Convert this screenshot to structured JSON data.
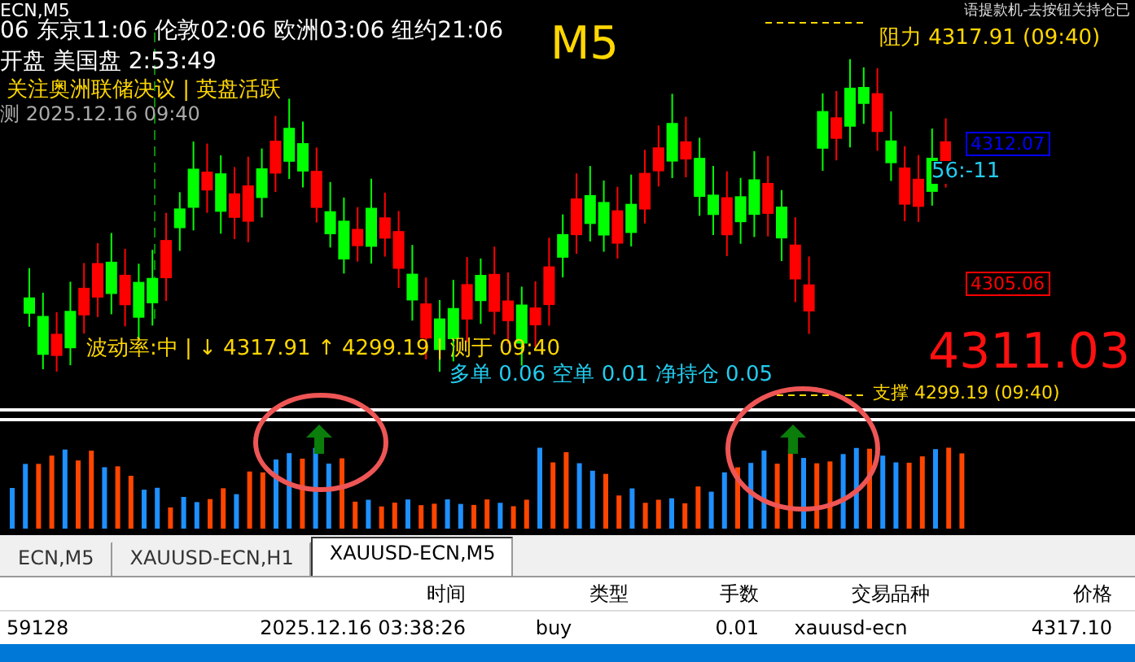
{
  "chart": {
    "symbol_label": "ECN,M5",
    "sessions": "06 东京11:06 伦敦02:06 欧洲03:06 纽约21:06",
    "open_line": "开盘 美国盘 2:53:49",
    "notice": "关注奥洲联储决议 | 英盘活跃",
    "measured": "测 2025.12.16 09:40",
    "timeframe": "M5",
    "banner": "语提款机-去按钮关持仓已",
    "resistance": "阻力 4317.91 (09:40)",
    "price_tags": [
      {
        "text": "4312.07",
        "color": "#0000ff"
      },
      {
        "text": "4305.06",
        "color": "#ff0000"
      }
    ],
    "countdown": "56:-11",
    "volatility": "波动率:中 | ↓ 4317.91 ↑ 4299.19 | 测于 09:40",
    "positions": "多单 0.06 空单 0.01 净持仓 0.05",
    "bid": "4311.03",
    "support": "支撑 4299.19 (09:40)"
  },
  "tabs": [
    {
      "label": "ECN,M5",
      "selected": false
    },
    {
      "label": "XAUUSD-ECN,H1",
      "selected": false
    },
    {
      "label": "XAUUSD-ECN,M5",
      "selected": true
    }
  ],
  "table": {
    "columns": [
      "时间",
      "类型",
      "手数",
      "交易品种",
      "价格"
    ],
    "rows": [
      {
        "cells": [
          "59128",
          "2025.12.16 03:38:26",
          "buy",
          "0.01",
          "xauusd-ecn",
          "4317.10"
        ],
        "selected": false
      },
      {
        "selected": true
      }
    ]
  }
}
